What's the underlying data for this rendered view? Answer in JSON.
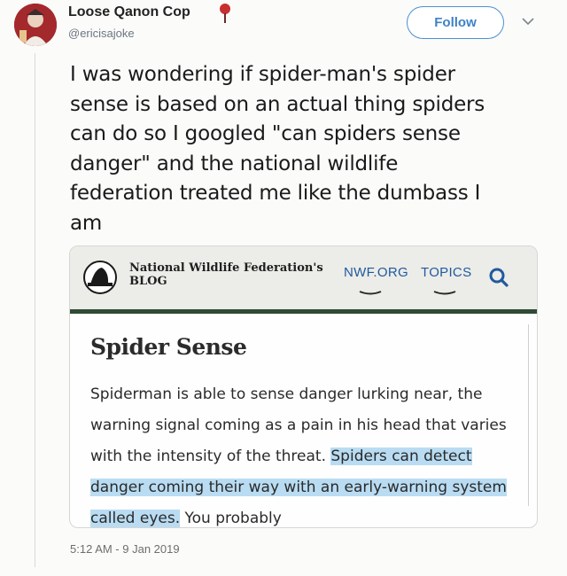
{
  "tweet": {
    "display_name": "Loose Qanon Cop",
    "handle": "@ericisajoke",
    "follow_label": "Follow",
    "text": "I was wondering if spider-man's spider\nsense is based on an actual thing spiders\ncan do so I googled \"can spiders sense\ndanger\" and the national wildlife\nfederation treated me like the dumbass I\nam",
    "timestamp": "5:12 AM - 9 Jan 2019"
  },
  "card": {
    "site_title_line1": "National Wildlife Federation's",
    "site_title_line2": "BLOG",
    "nav": [
      "NWF.ORG",
      "TOPICS"
    ],
    "heading": "Spider Sense",
    "body_plain": "Spiderman is able to sense danger lurking near, the warning signal coming as a pain in his head that varies with the intensity of the threat. ",
    "body_highlight": "Spiders can detect danger coming their way with an early-warning system called eyes.",
    "body_tail": " You probably"
  },
  "icons": {
    "avatar": "avatar-image",
    "pin": "pin-icon",
    "chevron": "chevron-down-icon",
    "logo": "nwf-logo-icon",
    "search": "search-icon"
  },
  "colors": {
    "follow_blue": "#3e82c5",
    "nav_blue": "#1f5a9e",
    "header_green": "#2f4a35",
    "highlight": "#b9dcf2"
  }
}
